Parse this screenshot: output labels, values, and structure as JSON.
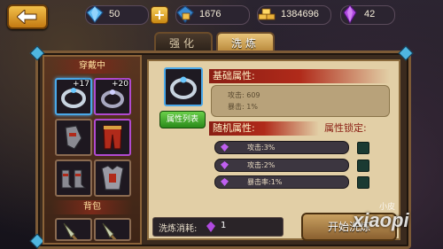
{
  "topbar": {
    "diamond_count": "50",
    "diamond_icon": "blue-diamond-icon",
    "locked_diamond_count": "1676",
    "gold_count": "1384696",
    "crystal_count": "42"
  },
  "tabs": [
    {
      "label": "强化",
      "active": false
    },
    {
      "label": "洗炼",
      "active": true
    }
  ],
  "left_panel": {
    "equipped_title": "穿戴中",
    "bag_title": "背包",
    "equipped_slots": [
      {
        "item": "ring",
        "level": "+17",
        "selected": true
      },
      {
        "item": "ring",
        "level": "+20",
        "selected": false
      },
      {
        "item": "gauntlet",
        "level": "",
        "selected": false
      },
      {
        "item": "pants",
        "level": "",
        "selected": false
      },
      {
        "item": "boots",
        "level": "",
        "selected": false
      },
      {
        "item": "armor",
        "level": "",
        "selected": false
      }
    ],
    "bag_slots": [
      {
        "item": "spear"
      },
      {
        "item": "spear"
      }
    ]
  },
  "right_panel": {
    "attr_list_button": "属性列表",
    "base_attr_title": "基础属性:",
    "base_attrs": [
      "攻击: 609",
      "暴击: 1%"
    ],
    "random_attr_title": "随机属性:",
    "attr_lock_title": "属性锁定:",
    "random_attrs": [
      "攻击:3%",
      "攻击:2%",
      "暴击率:1%"
    ],
    "refine_cost_label": "洗炼消耗:",
    "refine_cost_value": "1",
    "start_button": "开始洗炼"
  },
  "watermark": {
    "main": "xiaopi",
    "small": "小皮"
  },
  "colors": {
    "accent_gold": "#f2c04a",
    "selected_blue": "#4aa8e8",
    "header_red": "#b02a1a",
    "lock_green": "#1a3a32"
  }
}
